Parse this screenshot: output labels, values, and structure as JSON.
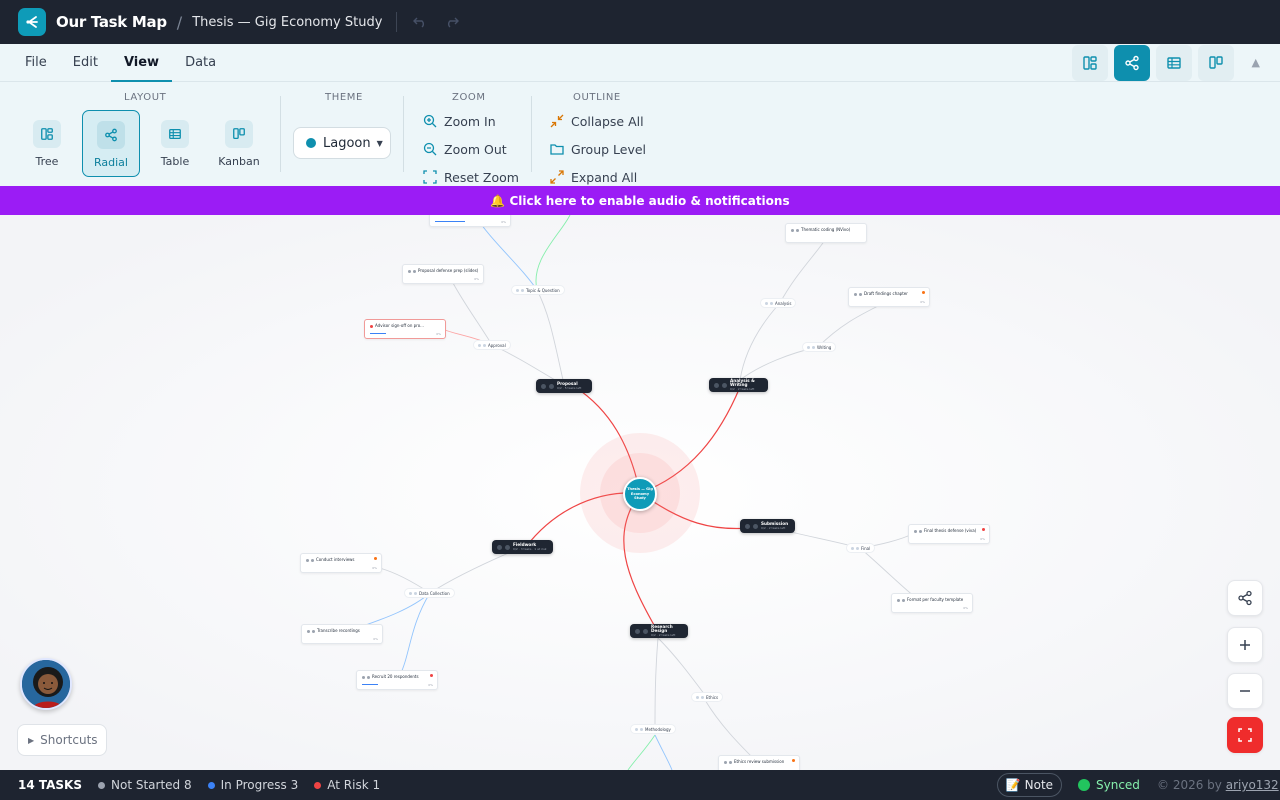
{
  "header": {
    "app_title": "Our Task Map",
    "separator": "/",
    "doc_title": "Thesis — Gig Economy Study",
    "undo_icon": "undo-icon",
    "redo_icon": "redo-icon"
  },
  "menu": {
    "items": [
      "File",
      "Edit",
      "View",
      "Data"
    ],
    "active": "View"
  },
  "ribbon": {
    "layout": {
      "title": "LAYOUT",
      "buttons": [
        {
          "label": "Tree",
          "icon": "tree-icon"
        },
        {
          "label": "Radial",
          "icon": "radial-icon",
          "active": true
        },
        {
          "label": "Table",
          "icon": "table-icon"
        },
        {
          "label": "Kanban",
          "icon": "kanban-icon"
        }
      ]
    },
    "theme": {
      "title": "THEME",
      "value": "Lagoon",
      "color": "#0e8fae"
    },
    "zoom": {
      "title": "ZOOM",
      "zoom_in": "Zoom In",
      "zoom_out": "Zoom Out",
      "reset": "Reset Zoom"
    },
    "outline": {
      "title": "OUTLINE",
      "collapse_all": "Collapse All",
      "group_level": "Group Level",
      "expand_all": "Expand All"
    }
  },
  "banner": {
    "text": "🔔 Click here to enable audio & notifications",
    "color": "#9b1cf5"
  },
  "mindmap": {
    "root": "Thesis — Gig Economy Study",
    "branches": {
      "proposal": {
        "title": "Proposal",
        "sub": "0/2 · 5 tasks left"
      },
      "analysis": {
        "title": "Analysis & Writing",
        "sub": "0/2 · 2 tasks left"
      },
      "fieldwork": {
        "title": "Fieldwork",
        "sub": "0/2 · 3 tasks · 1 at risk"
      },
      "submission": {
        "title": "Submission",
        "sub": "0/2 · 2 tasks left"
      },
      "research": {
        "title": "Research Design",
        "sub": "0/2 · 2 tasks left"
      }
    },
    "groups": {
      "topic": "Topic & Question",
      "approval": "Approval",
      "analysis": "Analysis",
      "writing": "Writing",
      "data_collection": "Data Collection",
      "final": "Final",
      "ethics": "Ethics",
      "methodology": "Methodology"
    },
    "tasks": {
      "proposal_defense": "Proposal defense prep (slides)",
      "advisor_signoff": "Advisor sign-off on pro...",
      "thematic_coding": "Thematic coding (NVivo)",
      "draft_findings": "Draft findings chapter",
      "conduct_interviews": "Conduct interviews",
      "transcribe": "Transcribe recordings",
      "recruit": "Recruit 20 respondents",
      "final_defense": "Final thesis defense (viva)",
      "format_template": "Format per faculty template",
      "ethics_submission": "Ethics review submission"
    }
  },
  "floating_tools": [
    "share-icon",
    "zoom-in-icon",
    "zoom-out-icon",
    "fullscreen-icon"
  ],
  "shortcuts_label": "Shortcuts",
  "status": {
    "count": "14 TASKS",
    "not_started": "Not Started 8",
    "in_progress": "In Progress 3",
    "at_risk": "At Risk 1",
    "colors": {
      "not_started": "#9ca3af",
      "in_progress": "#3b82f6",
      "at_risk": "#ef4444"
    },
    "note": "📝 Note",
    "synced": "Synced",
    "copyright_prefix": "© 2026 by",
    "copyright_author": "ariyo132"
  }
}
